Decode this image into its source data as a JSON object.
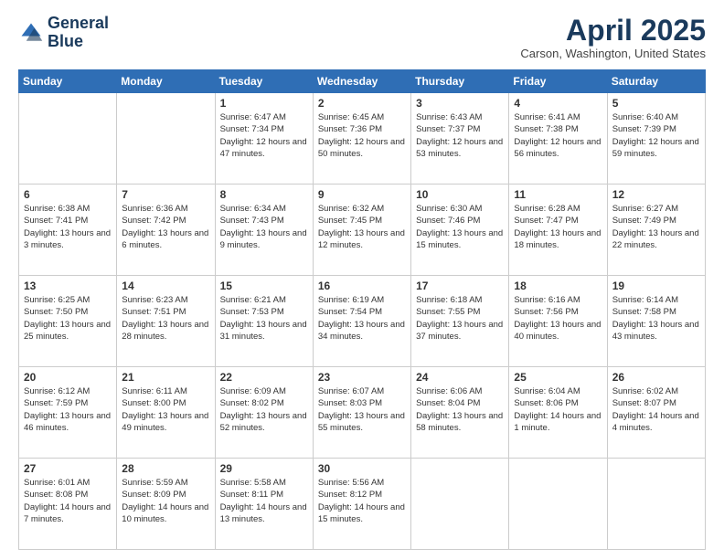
{
  "header": {
    "logo_line1": "General",
    "logo_line2": "Blue",
    "month": "April 2025",
    "location": "Carson, Washington, United States"
  },
  "weekdays": [
    "Sunday",
    "Monday",
    "Tuesday",
    "Wednesday",
    "Thursday",
    "Friday",
    "Saturday"
  ],
  "weeks": [
    [
      {
        "day": "",
        "info": ""
      },
      {
        "day": "",
        "info": ""
      },
      {
        "day": "1",
        "info": "Sunrise: 6:47 AM\nSunset: 7:34 PM\nDaylight: 12 hours and 47 minutes."
      },
      {
        "day": "2",
        "info": "Sunrise: 6:45 AM\nSunset: 7:36 PM\nDaylight: 12 hours and 50 minutes."
      },
      {
        "day": "3",
        "info": "Sunrise: 6:43 AM\nSunset: 7:37 PM\nDaylight: 12 hours and 53 minutes."
      },
      {
        "day": "4",
        "info": "Sunrise: 6:41 AM\nSunset: 7:38 PM\nDaylight: 12 hours and 56 minutes."
      },
      {
        "day": "5",
        "info": "Sunrise: 6:40 AM\nSunset: 7:39 PM\nDaylight: 12 hours and 59 minutes."
      }
    ],
    [
      {
        "day": "6",
        "info": "Sunrise: 6:38 AM\nSunset: 7:41 PM\nDaylight: 13 hours and 3 minutes."
      },
      {
        "day": "7",
        "info": "Sunrise: 6:36 AM\nSunset: 7:42 PM\nDaylight: 13 hours and 6 minutes."
      },
      {
        "day": "8",
        "info": "Sunrise: 6:34 AM\nSunset: 7:43 PM\nDaylight: 13 hours and 9 minutes."
      },
      {
        "day": "9",
        "info": "Sunrise: 6:32 AM\nSunset: 7:45 PM\nDaylight: 13 hours and 12 minutes."
      },
      {
        "day": "10",
        "info": "Sunrise: 6:30 AM\nSunset: 7:46 PM\nDaylight: 13 hours and 15 minutes."
      },
      {
        "day": "11",
        "info": "Sunrise: 6:28 AM\nSunset: 7:47 PM\nDaylight: 13 hours and 18 minutes."
      },
      {
        "day": "12",
        "info": "Sunrise: 6:27 AM\nSunset: 7:49 PM\nDaylight: 13 hours and 22 minutes."
      }
    ],
    [
      {
        "day": "13",
        "info": "Sunrise: 6:25 AM\nSunset: 7:50 PM\nDaylight: 13 hours and 25 minutes."
      },
      {
        "day": "14",
        "info": "Sunrise: 6:23 AM\nSunset: 7:51 PM\nDaylight: 13 hours and 28 minutes."
      },
      {
        "day": "15",
        "info": "Sunrise: 6:21 AM\nSunset: 7:53 PM\nDaylight: 13 hours and 31 minutes."
      },
      {
        "day": "16",
        "info": "Sunrise: 6:19 AM\nSunset: 7:54 PM\nDaylight: 13 hours and 34 minutes."
      },
      {
        "day": "17",
        "info": "Sunrise: 6:18 AM\nSunset: 7:55 PM\nDaylight: 13 hours and 37 minutes."
      },
      {
        "day": "18",
        "info": "Sunrise: 6:16 AM\nSunset: 7:56 PM\nDaylight: 13 hours and 40 minutes."
      },
      {
        "day": "19",
        "info": "Sunrise: 6:14 AM\nSunset: 7:58 PM\nDaylight: 13 hours and 43 minutes."
      }
    ],
    [
      {
        "day": "20",
        "info": "Sunrise: 6:12 AM\nSunset: 7:59 PM\nDaylight: 13 hours and 46 minutes."
      },
      {
        "day": "21",
        "info": "Sunrise: 6:11 AM\nSunset: 8:00 PM\nDaylight: 13 hours and 49 minutes."
      },
      {
        "day": "22",
        "info": "Sunrise: 6:09 AM\nSunset: 8:02 PM\nDaylight: 13 hours and 52 minutes."
      },
      {
        "day": "23",
        "info": "Sunrise: 6:07 AM\nSunset: 8:03 PM\nDaylight: 13 hours and 55 minutes."
      },
      {
        "day": "24",
        "info": "Sunrise: 6:06 AM\nSunset: 8:04 PM\nDaylight: 13 hours and 58 minutes."
      },
      {
        "day": "25",
        "info": "Sunrise: 6:04 AM\nSunset: 8:06 PM\nDaylight: 14 hours and 1 minute."
      },
      {
        "day": "26",
        "info": "Sunrise: 6:02 AM\nSunset: 8:07 PM\nDaylight: 14 hours and 4 minutes."
      }
    ],
    [
      {
        "day": "27",
        "info": "Sunrise: 6:01 AM\nSunset: 8:08 PM\nDaylight: 14 hours and 7 minutes."
      },
      {
        "day": "28",
        "info": "Sunrise: 5:59 AM\nSunset: 8:09 PM\nDaylight: 14 hours and 10 minutes."
      },
      {
        "day": "29",
        "info": "Sunrise: 5:58 AM\nSunset: 8:11 PM\nDaylight: 14 hours and 13 minutes."
      },
      {
        "day": "30",
        "info": "Sunrise: 5:56 AM\nSunset: 8:12 PM\nDaylight: 14 hours and 15 minutes."
      },
      {
        "day": "",
        "info": ""
      },
      {
        "day": "",
        "info": ""
      },
      {
        "day": "",
        "info": ""
      }
    ]
  ]
}
